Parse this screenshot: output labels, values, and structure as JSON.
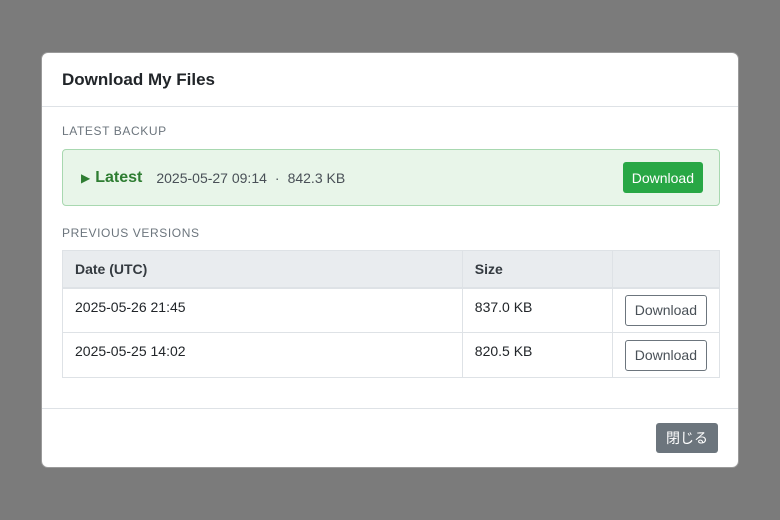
{
  "modal": {
    "title": "Download My Files"
  },
  "latest": {
    "section_label": "LATEST BACKUP",
    "arrow_icon": "play-triangle-icon",
    "name": "Latest",
    "timestamp": "2025-05-27 09:14",
    "separator": "·",
    "size": "842.3 KB",
    "download_label": "Download"
  },
  "previous": {
    "section_label": "PREVIOUS VERSIONS",
    "columns": [
      "Date (UTC)",
      "Size",
      ""
    ],
    "rows": [
      {
        "date": "2025-05-26 21:45",
        "size": "837.0 KB",
        "action": "Download"
      },
      {
        "date": "2025-05-25 14:02",
        "size": "820.5 KB",
        "action": "Download"
      }
    ]
  },
  "footer": {
    "close_label": "閉じる"
  },
  "colors": {
    "overlay": "#7b7b7b",
    "success": "#28a745",
    "latest_bg": "#e8f5e9",
    "latest_text": "#2e7d32",
    "secondary": "#6c757d"
  }
}
